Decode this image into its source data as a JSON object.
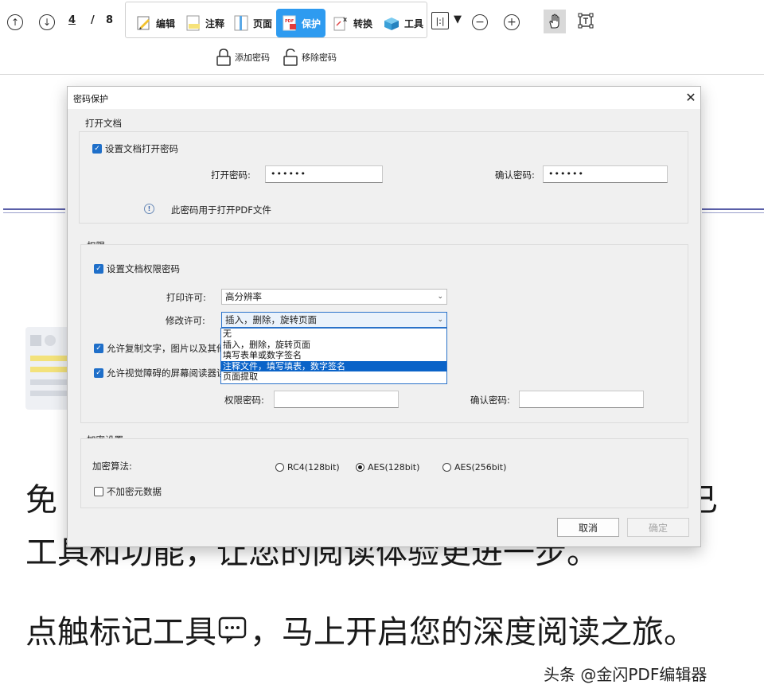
{
  "toolbar": {
    "current_page": "4",
    "page_separator": "/",
    "total_pages": "8",
    "tools": [
      {
        "label": "编辑",
        "icon": "edit-icon"
      },
      {
        "label": "注释",
        "icon": "annotate-icon"
      },
      {
        "label": "页面",
        "icon": "page-icon"
      },
      {
        "label": "保护",
        "icon": "protect-icon",
        "active": true
      },
      {
        "label": "转换",
        "icon": "convert-icon"
      },
      {
        "label": "工具",
        "icon": "tools-icon"
      }
    ],
    "subtools": {
      "add_password": "添加密码",
      "remove_password": "移除密码"
    },
    "colors": {
      "active_tab": "#2e9bf0"
    }
  },
  "document": {
    "line1_left": "免",
    "line1_right": "已",
    "line2": "工具和功能，让您的阅读体验更进一步。",
    "line3_before": "点触标记工具",
    "line3_after": "，马上开启您的深度阅读之旅。",
    "watermark": "头条 @金闪PDF编辑器"
  },
  "dialog": {
    "title": "密码保护",
    "open_section": {
      "title": "打开文档",
      "checkbox_label": "设置文档打开密码",
      "checked": true,
      "open_password_label": "打开密码:",
      "open_password_value": "••••••",
      "confirm_password_label": "确认密码:",
      "confirm_password_value": "••••••",
      "info_text": "此密码用于打开PDF文件"
    },
    "permissions_section": {
      "title": "权限",
      "checkbox_label": "设置文档权限密码",
      "checked": true,
      "print_label": "打印许可:",
      "print_value": "高分辨率",
      "modify_label": "修改许可:",
      "modify_value": "插入，删除，旋转页面",
      "modify_options": [
        "无",
        "插入，删除，旋转页面",
        "填写表单或数字签名",
        "注释文件，填写填表，数字签名",
        "页面提取"
      ],
      "modify_highlighted_index": 3,
      "allow_copy_label": "允许复制文字，图片以及其他",
      "allow_copy_checked": true,
      "allow_screen_reader_label": "允许视觉障碍的屏幕阅读器读取",
      "allow_screen_reader_checked": true,
      "perm_password_label": "权限密码:",
      "perm_password_value": "",
      "confirm_password_label": "确认密码:",
      "confirm_password_value": ""
    },
    "encryption_section": {
      "title": "加密设置",
      "algorithm_label": "加密算法:",
      "options": [
        {
          "label": "RC4(128bit)",
          "selected": false
        },
        {
          "label": "AES(128bit)",
          "selected": true
        },
        {
          "label": "AES(256bit)",
          "selected": false
        }
      ],
      "no_encrypt_metadata_label": "不加密元数据",
      "no_encrypt_metadata_checked": false
    },
    "buttons": {
      "cancel": "取消",
      "ok": "确定"
    }
  }
}
